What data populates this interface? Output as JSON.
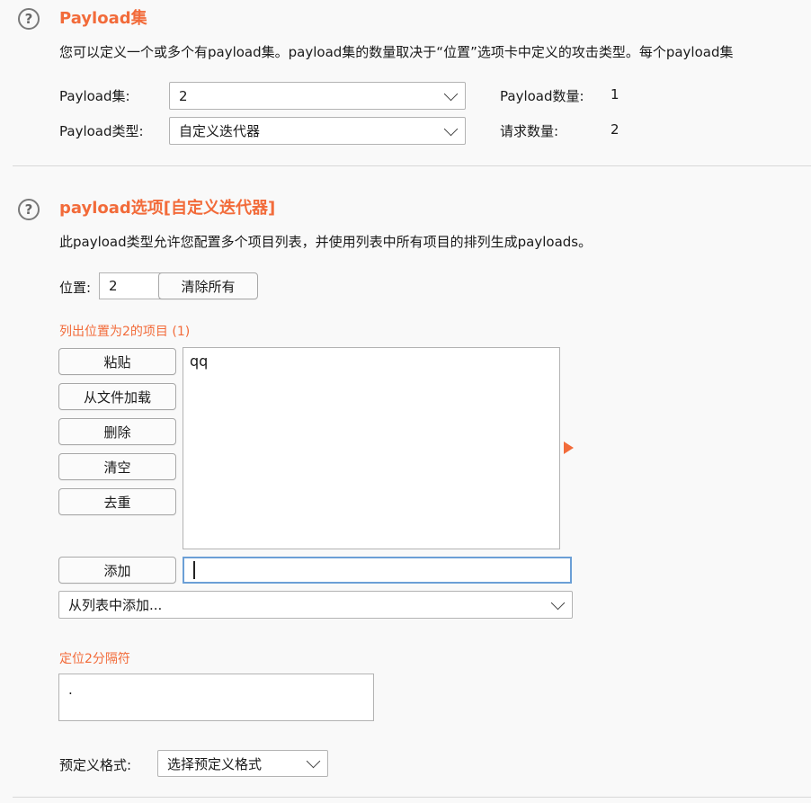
{
  "payload_sets": {
    "title": "Payload集",
    "description": "您可以定义一个或多个有payload集。payload集的数量取决于“位置”选项卡中定义的攻击类型。每个payload集",
    "set_label": "Payload集:",
    "set_value": "2",
    "type_label": "Payload类型:",
    "type_value": "自定义迭代器",
    "count_label": "Payload数量:",
    "count_value": "1",
    "requests_label": "请求数量:",
    "requests_value": "2"
  },
  "payload_options": {
    "title": "payload选项[自定义迭代器]",
    "description": "此payload类型允许您配置多个项目列表，并使用列表中所有项目的排列生成payloads。",
    "position_label": "位置:",
    "position_value": "2",
    "clear_all_label": "清除所有",
    "list_heading": "列出位置为2的项目 (1)",
    "buttons": {
      "paste": "粘贴",
      "load": "从文件加载",
      "remove": "删除",
      "clear": "清空",
      "dedupe": "去重",
      "add": "添加"
    },
    "list_items": [
      "qq"
    ],
    "add_input_value": "",
    "add_from_list_label": "从列表中添加...",
    "separator_label": "定位2分隔符",
    "separator_value": ".",
    "predefined_label": "预定义格式:",
    "predefined_value": "选择预定义格式"
  },
  "colors": {
    "accent": "#f26b3a",
    "background": "#f9f9f9",
    "focus_border": "#6b9fd6"
  }
}
